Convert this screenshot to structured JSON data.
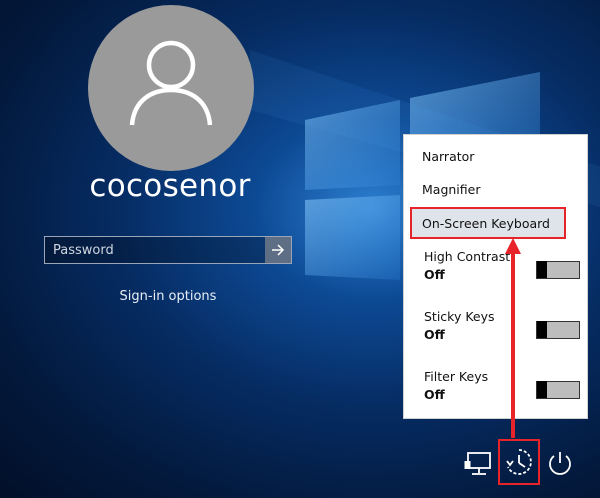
{
  "user": {
    "name": "cocosenor"
  },
  "password": {
    "placeholder": "Password"
  },
  "signin_options_label": "Sign-in options",
  "ease_of_access_menu": {
    "items": [
      {
        "label": "Narrator"
      },
      {
        "label": "Magnifier"
      },
      {
        "label": "On-Screen Keyboard",
        "highlighted": true
      }
    ],
    "toggles": [
      {
        "label": "High Contrast",
        "state": "Off",
        "on": false
      },
      {
        "label": "Sticky Keys",
        "state": "Off",
        "on": false
      },
      {
        "label": "Filter Keys",
        "state": "Off",
        "on": false
      }
    ]
  },
  "taskbar": {
    "icons": [
      "network-icon",
      "ease-of-access-icon",
      "power-icon"
    ]
  },
  "colors": {
    "accent_red": "#e8242b",
    "tile_gray": "#9a9a9a"
  }
}
